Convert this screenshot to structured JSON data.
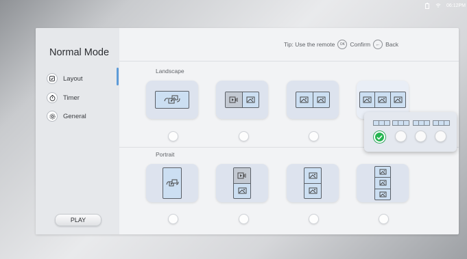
{
  "status": {
    "time": "06:12PM",
    "icons": [
      "battery-icon",
      "wifi-icon"
    ]
  },
  "sidebar": {
    "title": "Normal Mode",
    "items": [
      {
        "label": "Layout",
        "icon": "layout-icon"
      },
      {
        "label": "Timer",
        "icon": "timer-icon"
      },
      {
        "label": "General",
        "icon": "gear-icon"
      }
    ],
    "play_label": "PLAY"
  },
  "tip": {
    "text": "Tip: Use the remote",
    "ok_icon": "OK",
    "confirm": "Confirm",
    "back": "Back"
  },
  "sections": {
    "landscape": "Landscape",
    "portrait": "Portrait"
  },
  "colors": {
    "accent": "#5d9bd8",
    "selected": "#27b552"
  }
}
